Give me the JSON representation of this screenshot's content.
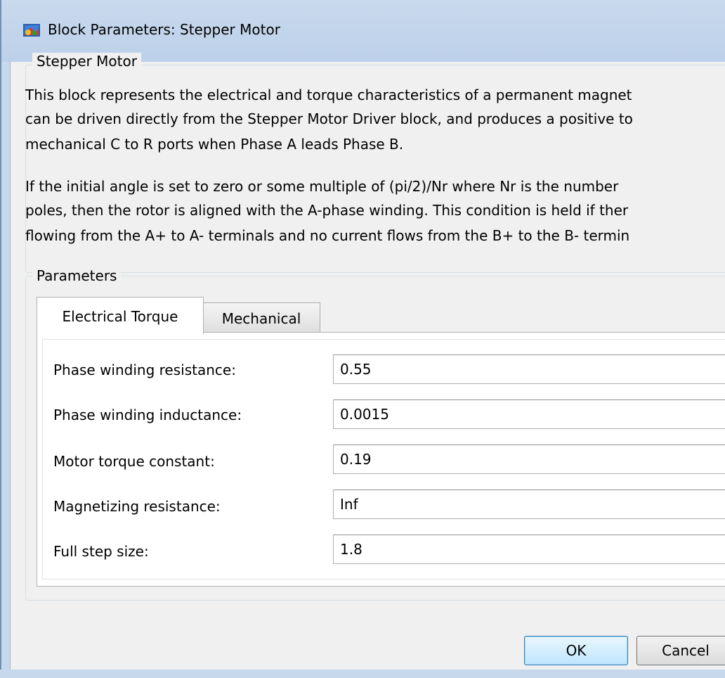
{
  "window": {
    "title": "Block Parameters: Stepper Motor"
  },
  "description_group": {
    "legend": "Stepper Motor",
    "paragraph1_lines": [
      "This block represents the electrical and torque characteristics of a permanent magnet",
      "can be driven directly from the Stepper Motor Driver block, and produces a positive to",
      "mechanical C to R ports when Phase A leads Phase B."
    ],
    "paragraph2_lines": [
      "If the initial angle is set to zero or some multiple of (pi/2)/Nr where Nr is the number",
      "poles, then the rotor is aligned with the A-phase winding. This condition is held if ther",
      "flowing from the A+ to A- terminals and no current flows from the B+ to the B- termin"
    ]
  },
  "parameters_group": {
    "legend": "Parameters",
    "tabs": [
      {
        "label": "Electrical Torque",
        "active": true
      },
      {
        "label": "Mechanical",
        "active": false
      }
    ],
    "fields": [
      {
        "label": "Phase winding resistance:",
        "value": "0.55"
      },
      {
        "label": "Phase winding inductance:",
        "value": "0.0015"
      },
      {
        "label": "Motor torque constant:",
        "value": "0.19"
      },
      {
        "label": "Magnetizing resistance:",
        "value": "Inf"
      },
      {
        "label": "Full step size:",
        "value": "1.8"
      }
    ]
  },
  "buttons": {
    "ok_label": "OK",
    "cancel_label": "Cancel"
  },
  "icons": {
    "title_icon": "simulink-block-icon"
  }
}
